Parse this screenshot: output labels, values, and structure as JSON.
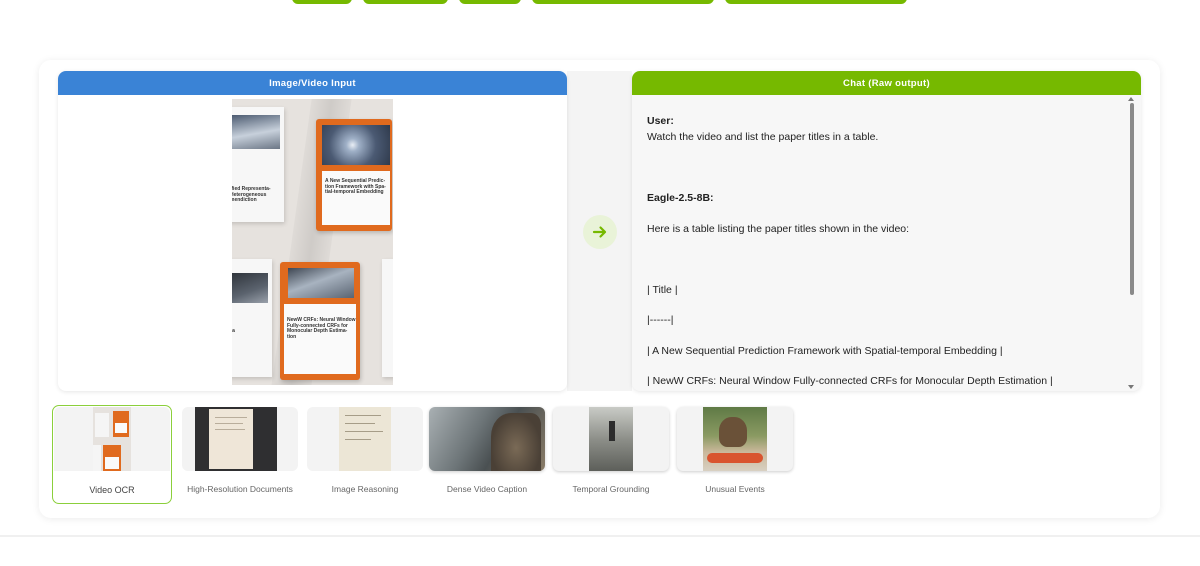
{
  "input_panel": {
    "title": "Image/Video Input"
  },
  "chat_panel": {
    "title": "Chat (Raw output)",
    "lines": [
      {
        "text": "User:",
        "bold": true
      },
      {
        "text": "Watch the video and list the paper titles in a table.",
        "bold": false
      },
      {
        "text": "Eagle-2.5-8B:",
        "bold": true
      },
      {
        "text": "Here is a table listing the paper titles shown in the video:",
        "bold": false
      },
      {
        "text": "| Title |",
        "bold": false
      },
      {
        "text": "|------|",
        "bold": false
      },
      {
        "text": "| A New Sequential Prediction Framework with Spatial-temporal Embedding |",
        "bold": false
      },
      {
        "text": "| NewW CRFs: Neural Window Fully-connected CRFs for Monocular Depth Estimation |",
        "bold": false
      }
    ]
  },
  "submit_button": {
    "icon": "arrow-right-icon",
    "color": "#76b900"
  },
  "video_frame": {
    "paper1_text": "ified Representa-\nHeterogeneous\nmendiction",
    "paper2_text": "A New Sequential Predic-\ntion Framework with Spa-\ntial-temporal Embedding",
    "paper3_text": "NewW CRFs: Neural Window\nFully-connected CRFs for\nMonocular Depth Estima-\ntion",
    "paper4_text": "ica"
  },
  "examples": [
    {
      "label": "Video OCR",
      "selected": true
    },
    {
      "label": "High-Resolution Documents",
      "selected": false
    },
    {
      "label": "Image Reasoning",
      "selected": false
    },
    {
      "label": "Dense Video Caption",
      "selected": false
    },
    {
      "label": "Temporal Grounding",
      "selected": false
    },
    {
      "label": "Unusual Events",
      "selected": false
    }
  ],
  "colors": {
    "accent_green": "#76b900",
    "accent_blue": "#3a83d6"
  }
}
